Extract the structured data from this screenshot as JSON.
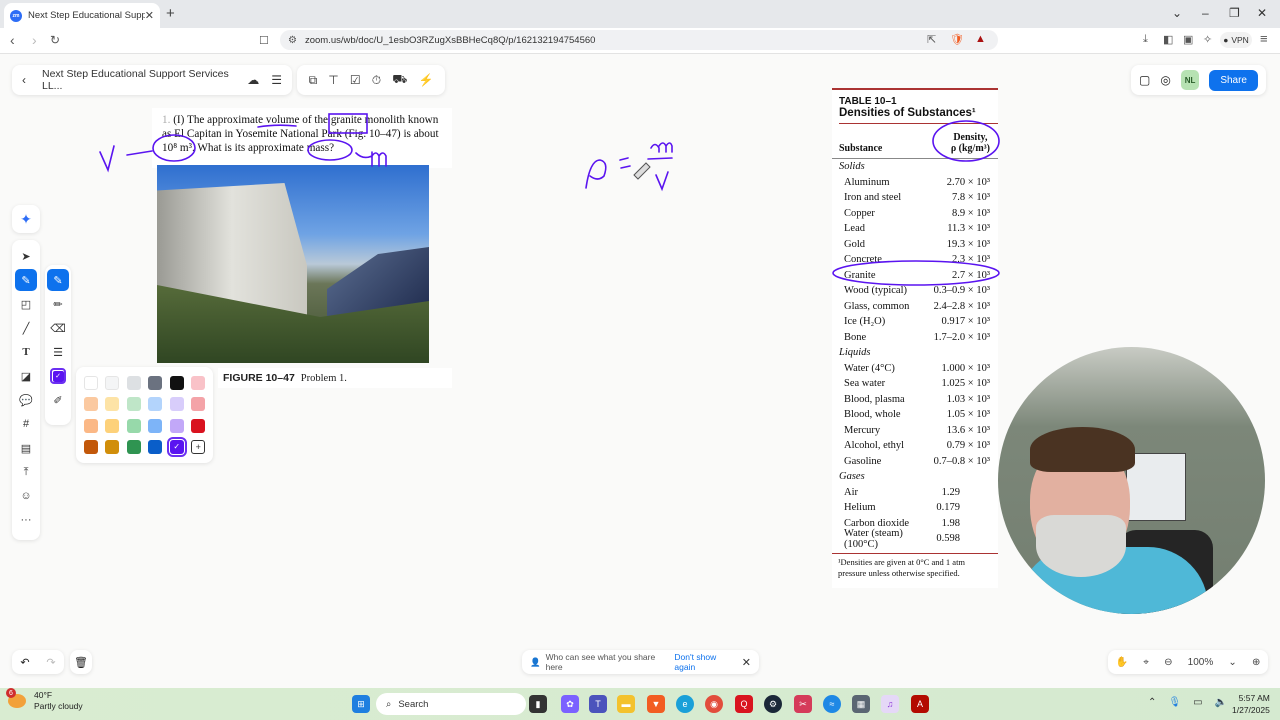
{
  "browser": {
    "tab_title": "Next Step Educational Support",
    "tab_favicon": "zoom-icon",
    "url": "zoom.us/wb/doc/U_1esbO3RZugXsBBHeCq8Q/p/162132194754560",
    "vpn_label": "VPN",
    "notification_count": "1"
  },
  "whiteboard": {
    "doc_title": "Next Step Educational Support Services LL...",
    "avatar_initials": "NL",
    "share_label": "Share",
    "zoom_level": "100%",
    "notice_text": "Who can see what you share here",
    "notice_link": "Don't show again",
    "selected_color": "#5a14f0",
    "palette": [
      "#ffffff",
      "#f4f5f6",
      "#dde0e3",
      "#6b7280",
      "#111111",
      "#f9c2c8",
      "#fbc9a0",
      "#fde3a6",
      "#bfe6c8",
      "#b3d4fc",
      "#d8cdfb",
      "#f4a3a8",
      "#fbb886",
      "#fdd17a",
      "#97d9aa",
      "#7db4f8",
      "#c2a8f8",
      "#d9121f",
      "#c2580a",
      "#d18e0a",
      "#2f9451",
      "#0a5ec9",
      "#5a14f0"
    ]
  },
  "problem": {
    "number": "1.",
    "level": "(I)",
    "text": "The approximate volume of the granite monolith known as El Capitan in Yosemite National Park (Fig. 10–47) is about 10⁸ m³. What is its approximate mass?",
    "line1": "The approximate volume of the granite monolith known",
    "line2": "as El Capitan in Yosemite National Park (Fig. 10–47) is about",
    "line3": "10⁸ m³. What is its approximate mass?",
    "figure_label": "FIGURE 10–47",
    "figure_caption": "Problem 1."
  },
  "handwriting": {
    "volume_symbol": "V",
    "mass_symbol": "m",
    "formula": "ρ = m / V"
  },
  "density_table": {
    "label": "TABLE 10–1",
    "title": "Densities of Substances¹",
    "col_substance": "Substance",
    "col_density_1": "Density,",
    "col_density_2": "ρ (kg/m³)",
    "groups": [
      {
        "name": "Solids",
        "rows": [
          {
            "substance": "Aluminum",
            "density": "2.70 × 10³"
          },
          {
            "substance": "Iron and steel",
            "density": "7.8 × 10³"
          },
          {
            "substance": "Copper",
            "density": "8.9 × 10³"
          },
          {
            "substance": "Lead",
            "density": "11.3 × 10³"
          },
          {
            "substance": "Gold",
            "density": "19.3 × 10³"
          },
          {
            "substance": "Concrete",
            "density": "2.3 × 10³"
          },
          {
            "substance": "Granite",
            "density": "2.7 × 10³"
          },
          {
            "substance": "Wood (typical)",
            "density": "0.3–0.9 × 10³"
          },
          {
            "substance": "Glass, common",
            "density": "2.4–2.8 × 10³"
          },
          {
            "substance": "Ice (H₂O)",
            "density": "0.917 × 10³"
          },
          {
            "substance": "Bone",
            "density": "1.7–2.0 × 10³"
          }
        ]
      },
      {
        "name": "Liquids",
        "rows": [
          {
            "substance": "Water (4°C)",
            "density": "1.000 × 10³"
          },
          {
            "substance": "Sea water",
            "density": "1.025 × 10³"
          },
          {
            "substance": "Blood, plasma",
            "density": "1.03 × 10³"
          },
          {
            "substance": "Blood, whole",
            "density": "1.05 × 10³"
          },
          {
            "substance": "Mercury",
            "density": "13.6 × 10³"
          },
          {
            "substance": "Alcohol, ethyl",
            "density": "0.79 × 10³"
          },
          {
            "substance": "Gasoline",
            "density": "0.7–0.8 × 10³"
          }
        ]
      },
      {
        "name": "Gases",
        "rows": [
          {
            "substance": "Air",
            "density": "1.29"
          },
          {
            "substance": "Helium",
            "density": "0.179"
          },
          {
            "substance": "Carbon dioxide",
            "density": "1.98"
          },
          {
            "substance": "Water (steam) (100°C)",
            "density": "0.598"
          }
        ]
      }
    ],
    "footnote": "¹Densities are given at 0°C and 1 atm pressure unless otherwise specified."
  },
  "taskbar": {
    "weather_temp": "40°F",
    "weather_desc": "Partly cloudy",
    "weather_badge": "6",
    "search_label": "Search",
    "time": "5:57 AM",
    "date": "1/27/2025"
  }
}
